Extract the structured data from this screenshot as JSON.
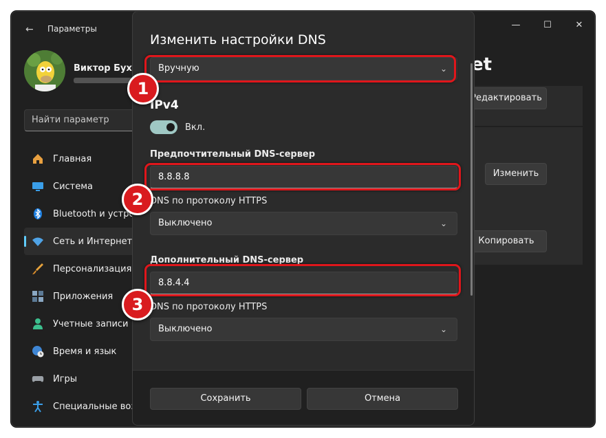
{
  "app": {
    "title": "Параметры"
  },
  "user": {
    "name": "Виктор Бухте"
  },
  "search": {
    "placeholder": "Найти параметр"
  },
  "nav": [
    {
      "label": "Главная",
      "icon": "home-icon",
      "active": false
    },
    {
      "label": "Система",
      "icon": "monitor-icon",
      "active": false
    },
    {
      "label": "Bluetooth и устро",
      "icon": "bluetooth-icon",
      "active": false
    },
    {
      "label": "Сеть и Интернет",
      "icon": "wifi-icon",
      "active": true
    },
    {
      "label": "Персонализация",
      "icon": "brush-icon",
      "active": false
    },
    {
      "label": "Приложения",
      "icon": "apps-icon",
      "active": false
    },
    {
      "label": "Учетные записи",
      "icon": "person-icon",
      "active": false
    },
    {
      "label": "Время и язык",
      "icon": "globe-clock-icon",
      "active": false
    },
    {
      "label": "Игры",
      "icon": "gamepad-icon",
      "active": false
    },
    {
      "label": "Специальные воз",
      "icon": "accessibility-icon",
      "active": false
    }
  ],
  "background": {
    "title_fragment": "et",
    "edit_label": "Редактировать",
    "change_label": "Изменить",
    "copy_label": "Копировать"
  },
  "dialog": {
    "title": "Изменить настройки DNS",
    "mode_value": "Вручную",
    "section": "IPv4",
    "toggle_label": "Вкл.",
    "preferred_label": "Предпочтительный DNS-сервер",
    "preferred_value": "8.8.8.8",
    "https1_label": "DNS по протоколу HTTPS",
    "https1_value": "Выключено",
    "alternate_label": "Дополнительный DNS-сервер",
    "alternate_value": "8.8.4.4",
    "https2_label": "DNS по протоколу HTTPS",
    "https2_value": "Выключено",
    "save_label": "Сохранить",
    "cancel_label": "Отмена"
  },
  "annotations": {
    "badge1": "1",
    "badge2": "2",
    "badge3": "3",
    "highlight_color": "#e0161b"
  }
}
